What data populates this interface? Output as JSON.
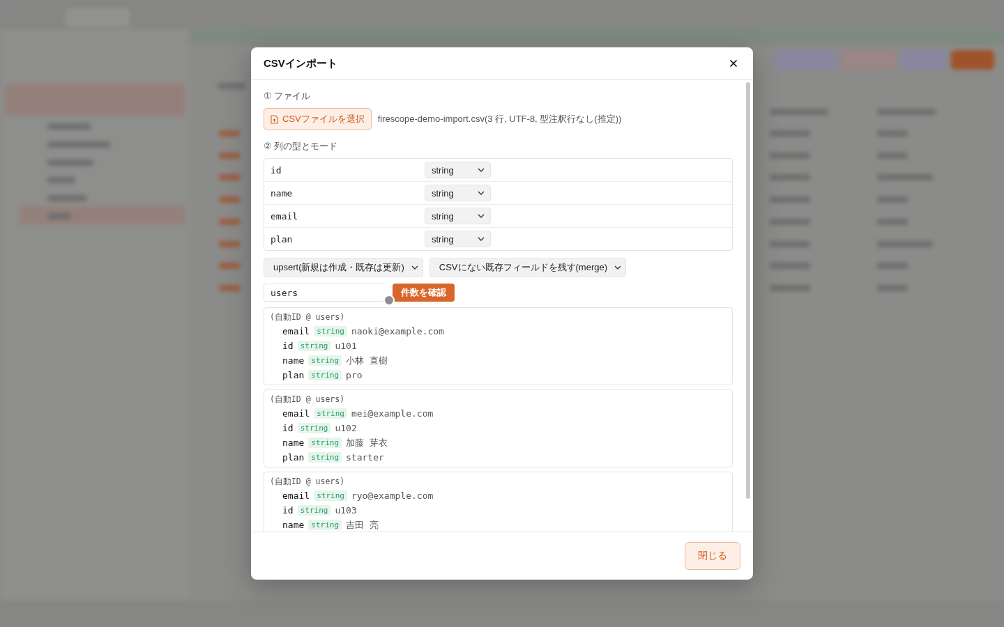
{
  "dialog": {
    "title": "CSVインポート",
    "file_section": {
      "label": "① ファイル",
      "choose_button": "CSVファイルを選択",
      "file_info": "firescope-demo-import.csv(3 行, UTF-8, 型注釈行なし(推定))"
    },
    "columns_section": {
      "label": "② 列の型とモード",
      "columns": [
        {
          "name": "id",
          "type": "string"
        },
        {
          "name": "name",
          "type": "string"
        },
        {
          "name": "email",
          "type": "string"
        },
        {
          "name": "plan",
          "type": "string"
        }
      ]
    },
    "mode_select": "upsert(新規は作成・既存は更新)",
    "merge_select": "CSVにない既存フィールドを残す(merge)",
    "collection_input": "users",
    "count_button": "件数を確認",
    "records": [
      {
        "header": "(自動ID @ users)",
        "fields": [
          {
            "key": "email",
            "type": "string",
            "value": "naoki@example.com"
          },
          {
            "key": "id",
            "type": "string",
            "value": "u101"
          },
          {
            "key": "name",
            "type": "string",
            "value": "小林 直樹"
          },
          {
            "key": "plan",
            "type": "string",
            "value": "pro"
          }
        ]
      },
      {
        "header": "(自動ID @ users)",
        "fields": [
          {
            "key": "email",
            "type": "string",
            "value": "mei@example.com"
          },
          {
            "key": "id",
            "type": "string",
            "value": "u102"
          },
          {
            "key": "name",
            "type": "string",
            "value": "加藤 芽衣"
          },
          {
            "key": "plan",
            "type": "string",
            "value": "starter"
          }
        ]
      },
      {
        "header": "(自動ID @ users)",
        "fields": [
          {
            "key": "email",
            "type": "string",
            "value": "ryo@example.com"
          },
          {
            "key": "id",
            "type": "string",
            "value": "u103"
          },
          {
            "key": "name",
            "type": "string",
            "value": "吉田 亮"
          }
        ]
      }
    ],
    "close_button": "閉じる"
  }
}
